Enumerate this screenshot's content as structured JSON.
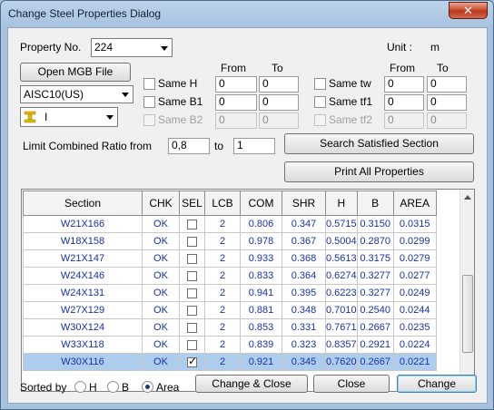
{
  "window": {
    "title": "Change Steel Properties Dialog",
    "close_glyph": "✕"
  },
  "property": {
    "label": "Property No.",
    "value": "224"
  },
  "unit": {
    "label": "Unit :",
    "value": "m"
  },
  "open_file_label": "Open MGB File",
  "database": {
    "value": "AISC10(US)"
  },
  "shape": {
    "value": "I",
    "icon": "i-beam-icon",
    "icon_color": "#e6b800"
  },
  "left_group": {
    "from_label": "From",
    "to_label": "To",
    "rows": [
      {
        "label": "Same H",
        "from": "0",
        "to": "0",
        "enabled": true
      },
      {
        "label": "Same B1",
        "from": "0",
        "to": "0",
        "enabled": true
      },
      {
        "label": "Same B2",
        "from": "0",
        "to": "0",
        "enabled": false
      }
    ]
  },
  "right_group": {
    "from_label": "From",
    "to_label": "To",
    "rows": [
      {
        "label": "Same tw",
        "from": "0",
        "to": "0",
        "enabled": true
      },
      {
        "label": "Same tf1",
        "from": "0",
        "to": "0",
        "enabled": true
      },
      {
        "label": "Same tf2",
        "from": "0",
        "to": "0",
        "enabled": false
      }
    ]
  },
  "ratio": {
    "label": "Limit Combined Ratio from",
    "from": "0,8",
    "to_label": "to",
    "to": "1"
  },
  "search_label": "Search Satisfied Section",
  "print_label": "Print All Properties",
  "table": {
    "columns": [
      "Section",
      "CHK",
      "SEL",
      "LCB",
      "COM",
      "SHR",
      "H",
      "B",
      "AREA"
    ],
    "rows": [
      {
        "section": "W21X166",
        "chk": "OK",
        "sel": false,
        "lcb": "2",
        "com": "0.806",
        "shr": "0.347",
        "h": "0.5715",
        "b": "0.3150",
        "area": "0.0315"
      },
      {
        "section": "W18X158",
        "chk": "OK",
        "sel": false,
        "lcb": "2",
        "com": "0.978",
        "shr": "0.367",
        "h": "0.5004",
        "b": "0.2870",
        "area": "0.0299"
      },
      {
        "section": "W21X147",
        "chk": "OK",
        "sel": false,
        "lcb": "2",
        "com": "0.933",
        "shr": "0.368",
        "h": "0.5613",
        "b": "0.3175",
        "area": "0.0279"
      },
      {
        "section": "W24X146",
        "chk": "OK",
        "sel": false,
        "lcb": "2",
        "com": "0.833",
        "shr": "0.364",
        "h": "0.6274",
        "b": "0.3277",
        "area": "0.0277"
      },
      {
        "section": "W24X131",
        "chk": "OK",
        "sel": false,
        "lcb": "2",
        "com": "0.941",
        "shr": "0.395",
        "h": "0.6223",
        "b": "0.3277",
        "area": "0.0249"
      },
      {
        "section": "W27X129",
        "chk": "OK",
        "sel": false,
        "lcb": "2",
        "com": "0.881",
        "shr": "0.348",
        "h": "0.7010",
        "b": "0.2540",
        "area": "0.0244"
      },
      {
        "section": "W30X124",
        "chk": "OK",
        "sel": false,
        "lcb": "2",
        "com": "0.853",
        "shr": "0.331",
        "h": "0.7671",
        "b": "0.2667",
        "area": "0.0235"
      },
      {
        "section": "W33X118",
        "chk": "OK",
        "sel": false,
        "lcb": "2",
        "com": "0.839",
        "shr": "0.323",
        "h": "0.8357",
        "b": "0.2921",
        "area": "0.0224"
      },
      {
        "section": "W30X116",
        "chk": "OK",
        "sel": true,
        "lcb": "2",
        "com": "0.921",
        "shr": "0.345",
        "h": "0.7620",
        "b": "0.2667",
        "area": "0.0221"
      }
    ]
  },
  "sort": {
    "label": "Sorted by",
    "options": [
      {
        "label": "H",
        "selected": false
      },
      {
        "label": "B",
        "selected": false
      },
      {
        "label": "Area",
        "selected": true
      }
    ]
  },
  "buttons": {
    "change_close": "Change & Close",
    "close": "Close",
    "change": "Change"
  }
}
